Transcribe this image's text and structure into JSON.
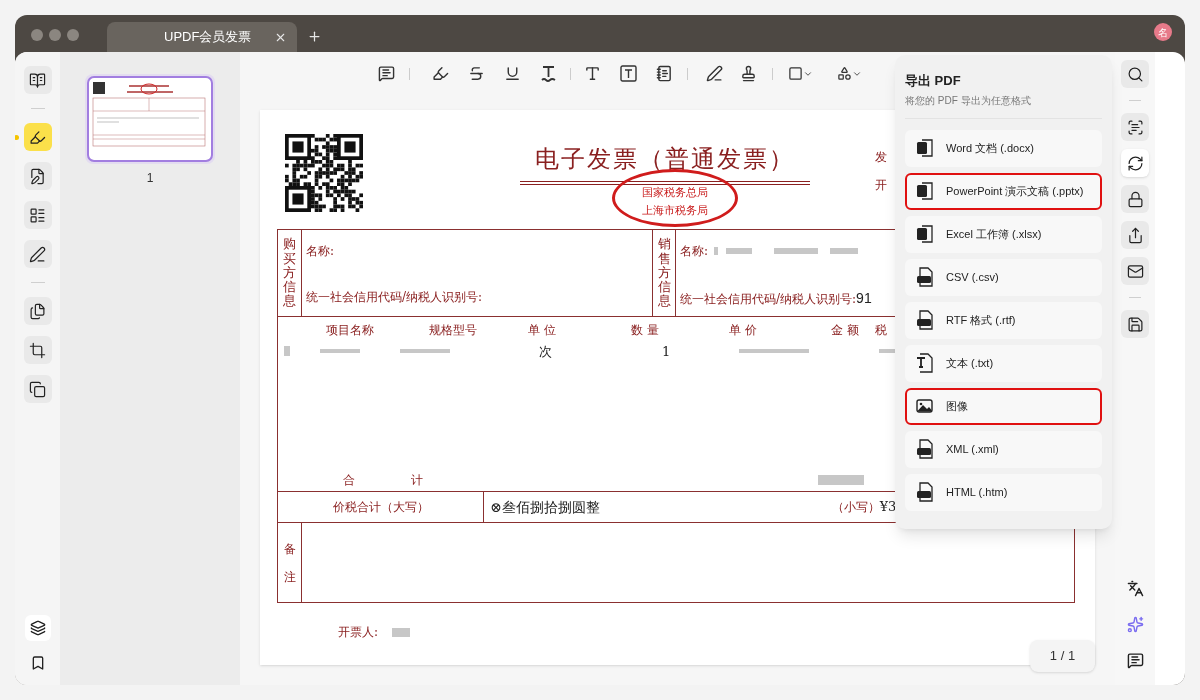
{
  "window": {
    "tab_title": "UPDF会员发票",
    "avatar": "名"
  },
  "left_rail": [
    [
      {
        "kind": "reader",
        "selected": false
      }
    ],
    [
      {
        "kind": "highlighter",
        "selected": true
      },
      {
        "kind": "edit",
        "selected": false
      },
      {
        "kind": "form",
        "selected": false
      },
      {
        "kind": "sign",
        "selected": false
      }
    ],
    [
      {
        "kind": "pages",
        "selected": false
      },
      {
        "kind": "crop",
        "selected": false
      },
      {
        "kind": "organize",
        "selected": false
      }
    ]
  ],
  "thumbnails": [
    {
      "label": "1",
      "selected": true
    }
  ],
  "invoice": {
    "title": "电子发票（普通发票）",
    "stamp": [
      "国家税务总局",
      "上海市税务局"
    ],
    "header_labels": [
      "发",
      "开"
    ],
    "buyer": {
      "side_label": "购买方信息",
      "name_label": "名称:",
      "tax_id_label": "统一社会信用代码/纳税人识别号:"
    },
    "seller": {
      "side_label": "销售方信息",
      "name_label": "名称:",
      "tax_id_label": "统一社会信用代码/纳税人识别号:",
      "tax_id_value": "91"
    },
    "item_columns": [
      "项目名称",
      "规格型号",
      "单 位",
      "数 量",
      "单 价",
      "金 额",
      "税"
    ],
    "item_rows": [
      {
        "unit": "次",
        "quantity": "1"
      }
    ],
    "total_label": [
      "合",
      "计"
    ],
    "amount_in_words_label": "价税合计（大写）",
    "amount_in_words": "⊗叁佰捌拾捌圆整",
    "amount_small_label": "（小写）",
    "amount_small": "¥3",
    "remarks_label": [
      "备",
      "注"
    ],
    "issuer_label": "开票人:"
  },
  "export_panel": {
    "title": "导出 PDF",
    "subtitle": "将您的 PDF 导出为任意格式",
    "items": [
      {
        "kind": "docx",
        "label": "Word 文档 (.docx)",
        "highlighted": false
      },
      {
        "kind": "pptx",
        "label": "PowerPoint 演示文稿 (.pptx)",
        "highlighted": true
      },
      {
        "kind": "xlsx",
        "label": "Excel 工作簿 (.xlsx)",
        "highlighted": false
      },
      {
        "kind": "csv",
        "label": "CSV (.csv)",
        "highlighted": false
      },
      {
        "kind": "rtf",
        "label": "RTF 格式 (.rtf)",
        "highlighted": false
      },
      {
        "kind": "txt",
        "label": "文本 (.txt)",
        "highlighted": false
      },
      {
        "kind": "image",
        "label": "图像",
        "highlighted": true
      },
      {
        "kind": "xml",
        "label": "XML (.xml)",
        "highlighted": false
      },
      {
        "kind": "html",
        "label": "HTML (.htm)",
        "highlighted": false
      }
    ]
  },
  "right_rail": [
    [
      {
        "kind": "search",
        "selected": false
      }
    ],
    [
      {
        "kind": "ocr",
        "selected": false
      },
      {
        "kind": "convert",
        "selected": true
      },
      {
        "kind": "protect",
        "selected": false
      },
      {
        "kind": "share",
        "selected": false
      },
      {
        "kind": "mail",
        "selected": false
      }
    ],
    [
      {
        "kind": "save",
        "selected": false
      }
    ]
  ],
  "page_indicator": "1 / 1"
}
